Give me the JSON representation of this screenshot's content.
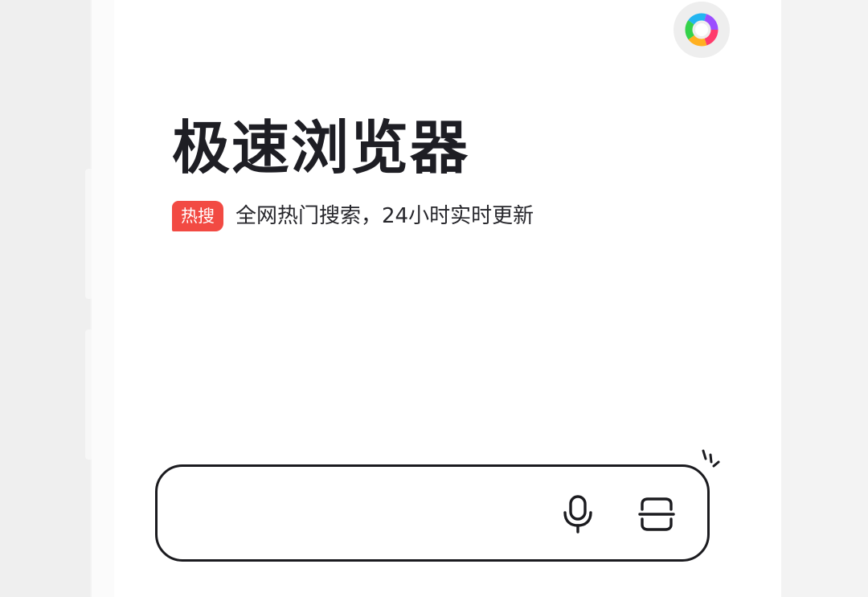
{
  "header": {
    "avatar_icon": "colorful-ring-logo-icon"
  },
  "hero": {
    "title": "极速浏览器",
    "badge": "热搜",
    "subtitle": "全网热门搜索，24小时实时更新"
  },
  "search": {
    "value": "",
    "placeholder": "",
    "mic_icon": "microphone-icon",
    "scan_icon": "scan-icon",
    "decoration_icon": "sparkle-icon"
  },
  "colors": {
    "badge_bg": "#f24a43",
    "title_text": "#1e1e24",
    "border": "#1b1b1f"
  }
}
